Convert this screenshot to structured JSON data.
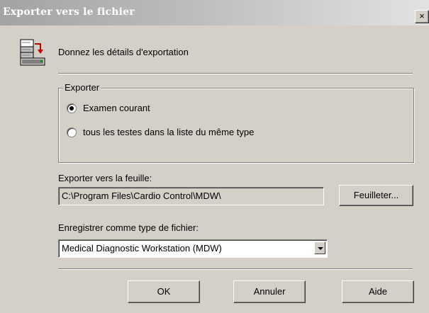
{
  "window": {
    "title": "Exporter vers le fichier",
    "close_label": "×"
  },
  "header": {
    "text": "Donnez les détails d'exportation",
    "icon": "export-database-icon"
  },
  "export_group": {
    "legend": "Exporter",
    "options": [
      {
        "label": "Examen courant",
        "selected": true
      },
      {
        "label": "tous les testes dans la liste du même type",
        "selected": false
      }
    ]
  },
  "destination": {
    "label": "Exporter vers la feuille:",
    "path": "C:\\Program Files\\Cardio Control\\MDW\\",
    "browse_label": "Feuilleter..."
  },
  "file_type": {
    "label": "Enregistrer comme type de fichier:",
    "selected": "Medical Diagnostic Workstation (MDW)"
  },
  "buttons": {
    "ok": "OK",
    "cancel": "Annuler",
    "help": "Aide"
  }
}
